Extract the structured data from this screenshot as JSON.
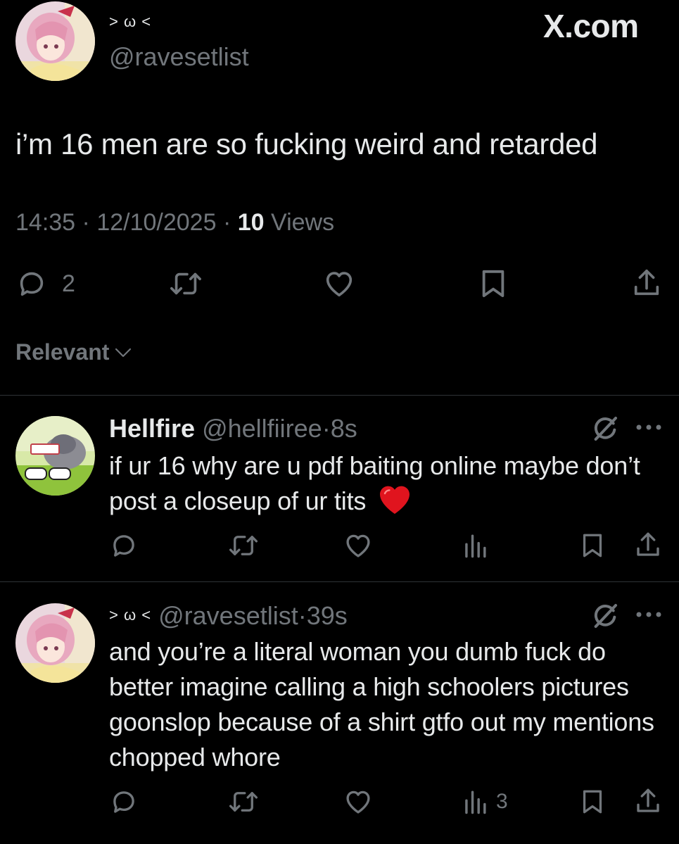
{
  "watermark": "X.com",
  "main_tweet": {
    "display_name": "> ω <",
    "handle": "@ravesetlist",
    "text": "i’m 16 men are so fucking weird and retarded",
    "time": "14:35",
    "date": "12/10/2025",
    "views_count": "10",
    "views_label": "Views",
    "reply_count": "2"
  },
  "sort": {
    "label": "Relevant"
  },
  "replies": [
    {
      "display_name": "Hellfire",
      "handle": "@hellfiiree",
      "age": "8s",
      "text": "if ur 16 why are u pdf baiting online maybe don’t post a closeup of ur tits",
      "emoji": "❤️",
      "views": ""
    },
    {
      "display_name": "> ω <",
      "handle": "@ravesetlist",
      "age": "39s",
      "text": "and you’re a literal woman you dumb fuck do better imagine calling a high schoolers pictures goonslop because of a shirt gtfo out my mentions chopped whore",
      "views": "3"
    }
  ],
  "icons": {
    "reply": "reply-icon",
    "retweet": "retweet-icon",
    "like": "like-icon",
    "bookmark": "bookmark-icon",
    "share": "share-icon",
    "views": "views-icon",
    "grok": "grok-icon",
    "more": "more-icon"
  },
  "colors": {
    "background": "#000000",
    "text": "#e7e9ea",
    "muted": "#71767b",
    "divider": "#2f3336",
    "heart": "#e0141e"
  }
}
